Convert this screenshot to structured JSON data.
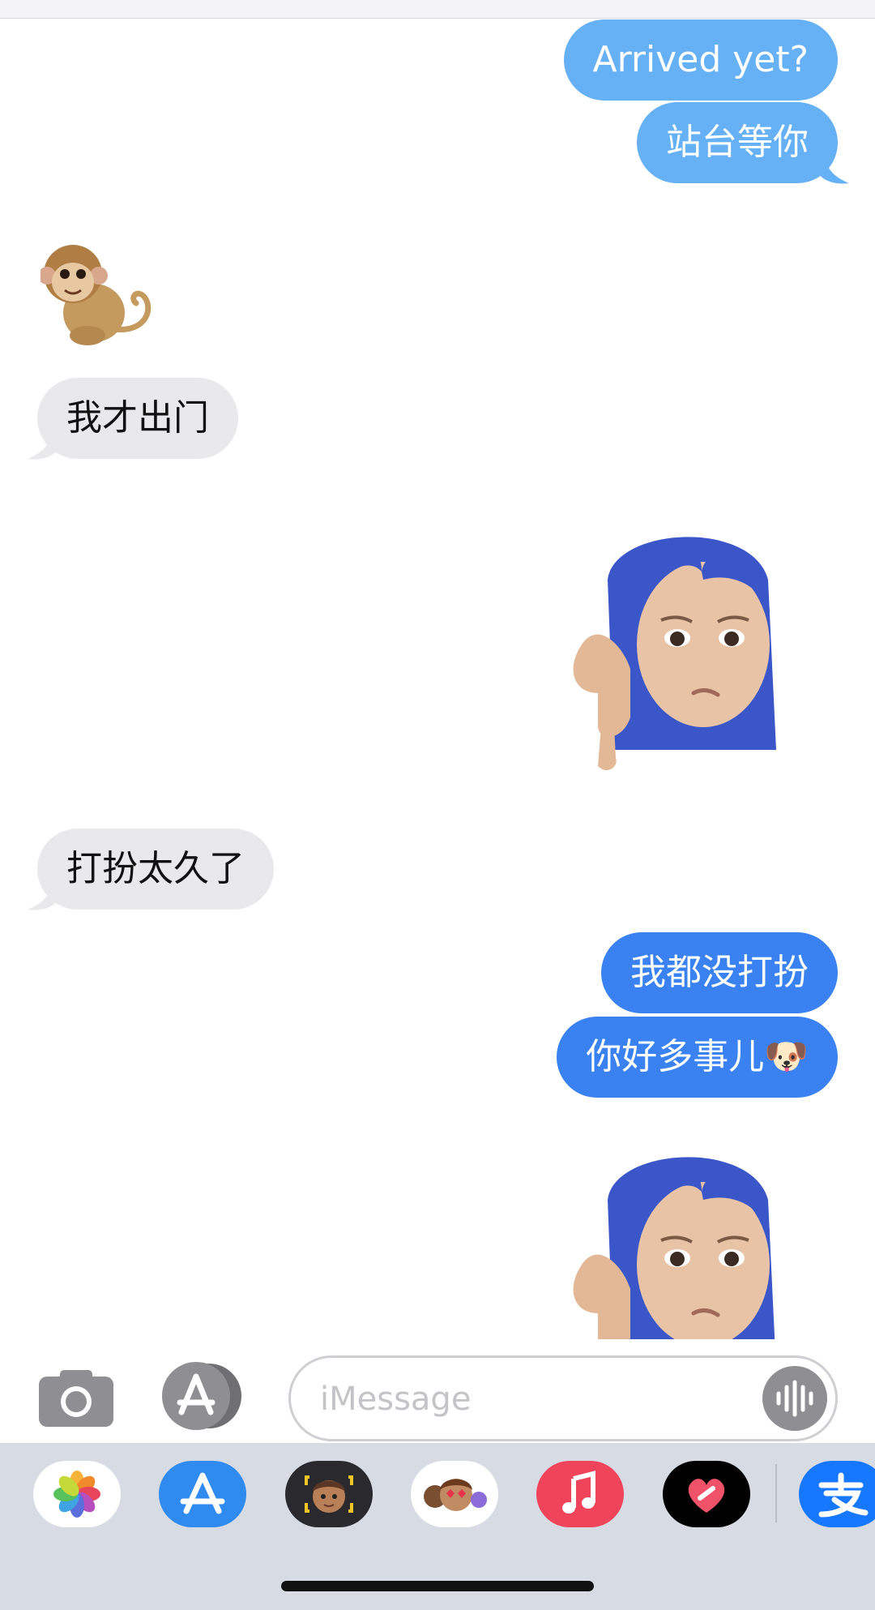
{
  "messages": {
    "m1": "Arrived yet?",
    "m2": "站台等你",
    "m3": "我才出门",
    "m4": "打扮太久了",
    "m5": "我都没打扮",
    "m6": "你好多事儿🐶"
  },
  "stickers": {
    "monkey": "monkey-emoji-sticker",
    "memoji_1": "memoji-thumbs-down-sticker",
    "memoji_2": "memoji-thumbs-down-sticker"
  },
  "composer": {
    "placeholder": "iMessage",
    "value": ""
  },
  "app_drawer": {
    "apps": [
      "photos-icon",
      "app-store-icon",
      "memoji-icon",
      "memoji-stickers-icon",
      "music-icon",
      "digital-touch-icon",
      "alipay-icon"
    ]
  },
  "colors": {
    "outgoing_light": "#66b0f6",
    "outgoing_dark": "#3a82f2",
    "incoming": "#e9e9eb",
    "app_bar": "#d6dbe4"
  }
}
